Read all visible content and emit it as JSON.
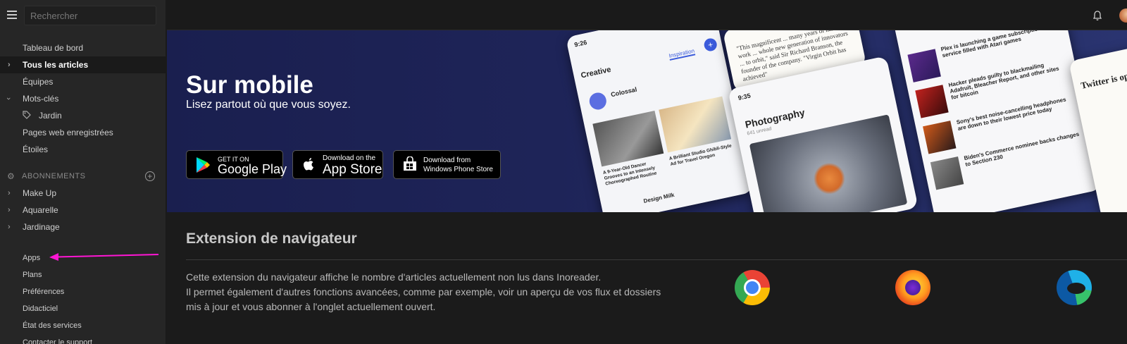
{
  "sidebar": {
    "search_placeholder": "Rechercher",
    "items": [
      {
        "label": "Tableau de bord"
      },
      {
        "label": "Tous les articles"
      },
      {
        "label": "Équipes"
      },
      {
        "label": "Mots-clés"
      },
      {
        "label": "Jardin"
      },
      {
        "label": "Pages web enregistrées"
      },
      {
        "label": "Étoiles"
      }
    ],
    "subscriptions_header": "ABONNEMENTS",
    "subscriptions": [
      {
        "label": "Make Up"
      },
      {
        "label": "Aquarelle"
      },
      {
        "label": "Jardinage"
      }
    ],
    "footer": [
      {
        "label": "Apps"
      },
      {
        "label": "Plans"
      },
      {
        "label": "Préférences"
      },
      {
        "label": "Didacticiel"
      },
      {
        "label": "État des services"
      },
      {
        "label": "Contacter le support"
      }
    ]
  },
  "hero": {
    "title": "Sur mobile",
    "subtitle": "Lisez partout où que vous soyez.",
    "google": {
      "small": "GET IT ON",
      "big": "Google Play"
    },
    "apple": {
      "small": "Download on the",
      "big": "App Store"
    },
    "windows": {
      "line1": "Download from",
      "line2": "Windows Phone Store"
    },
    "phone_left": {
      "time": "9:26",
      "title": "Creative",
      "tab": "Inspiration",
      "feed": "Colossal",
      "item1": "A 9-Year-Old Dancer Grooves to an Intensely Choreographed Routine",
      "item2": "A Brilliant Studio Ghibli-Style Ad for Travel Oregon",
      "footer": "Design Milk"
    },
    "phone_mid": {
      "time": "9:35",
      "title": "Photography",
      "meta": "641 unread"
    },
    "phone_right": {
      "item1": "Plex is launching a game subscription service filled with Atari games",
      "item2": "Hacker pleads guilty to blackmailing Adafruit, Bleacher Report, and other sites for bitcoin",
      "item3": "Sony's best noise-cancelling headphones are down to their lowest price today",
      "item4": "Biden's Commerce nominee backs changes to Section 230",
      "side": "Twitter is op free"
    },
    "quote": "\"This magnificent ... many years of hard work ... whole new generation of innovators ... to orbit,\" said Sir Richard Branson, the founder of the company. \"Virgin Orbit has achieved\""
  },
  "extension": {
    "title": "Extension de navigateur",
    "line1": "Cette extension du navigateur affiche le nombre d'articles actuellement non lus dans Inoreader.",
    "line2": "Il permet également d'autres fonctions avancées, comme par exemple, voir un aperçu de vos flux et dossiers",
    "line3": "mis à jour et vous abonner à l'onglet actuellement ouvert."
  },
  "colors": {
    "accent": "#ff16d4",
    "hero_bg": "#1e2458"
  }
}
